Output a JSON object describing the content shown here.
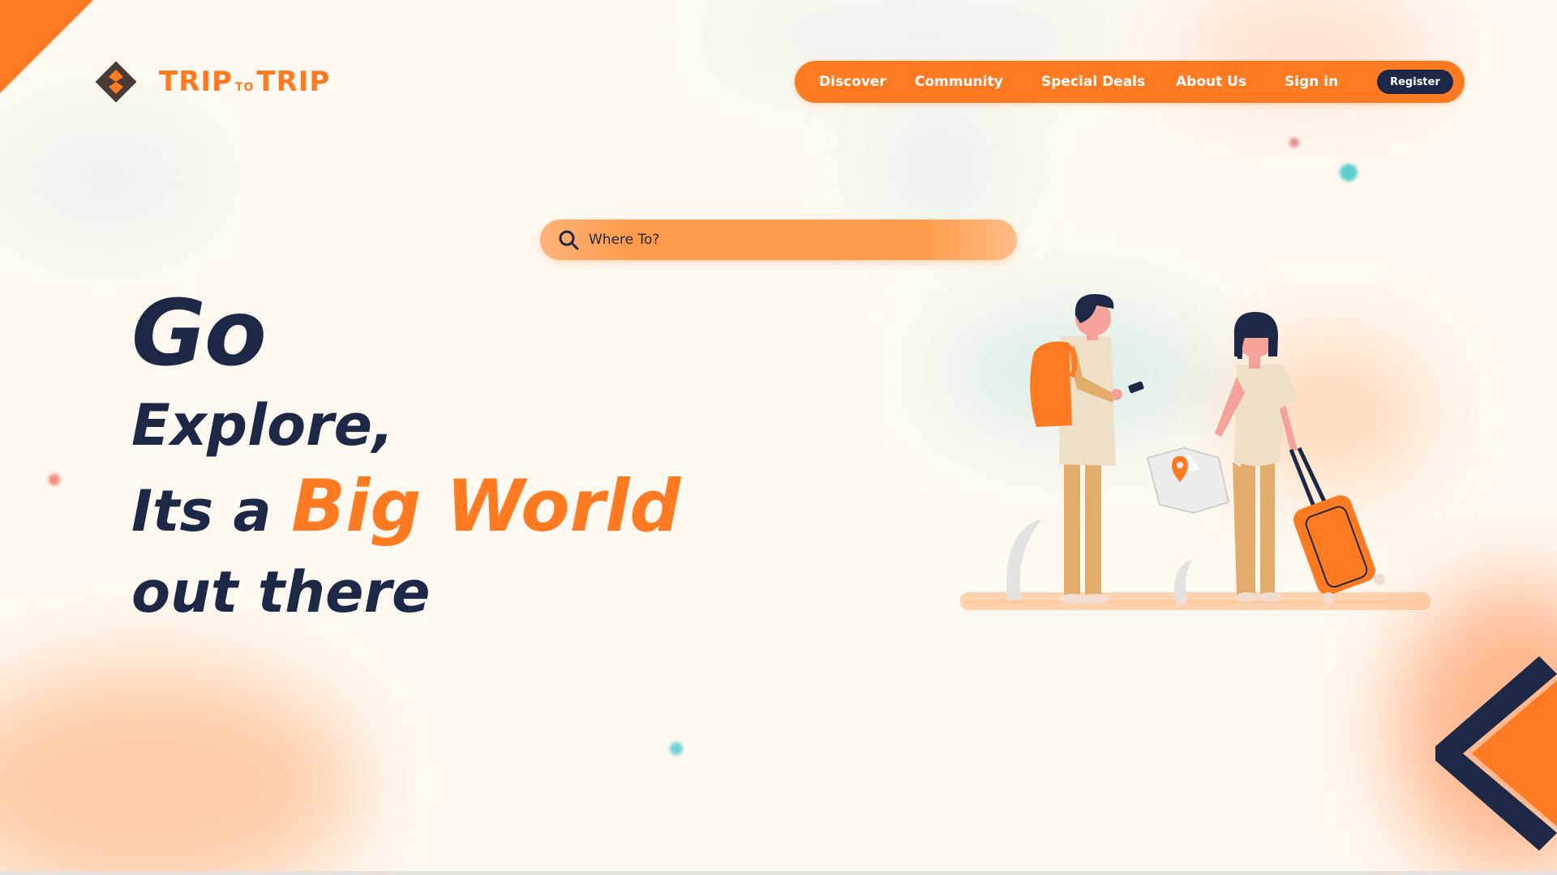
{
  "brand": {
    "name_part1": "TRIP",
    "name_connector": "TO",
    "name_part2": "TRIP",
    "primary_color": "#ff7a21",
    "dark_color": "#1d2847"
  },
  "nav": {
    "items": [
      {
        "label": "Discover"
      },
      {
        "label": "Community"
      },
      {
        "label": "Special Deals"
      },
      {
        "label": "About Us"
      },
      {
        "label": "Sign in"
      }
    ],
    "register_label": "Register"
  },
  "search": {
    "placeholder": "Where To?",
    "icon": "search-icon"
  },
  "hero": {
    "line1": "Go",
    "line2": "Explore,",
    "line3_prefix": "Its a",
    "line3_accent": "Big World",
    "line4": "out there"
  }
}
